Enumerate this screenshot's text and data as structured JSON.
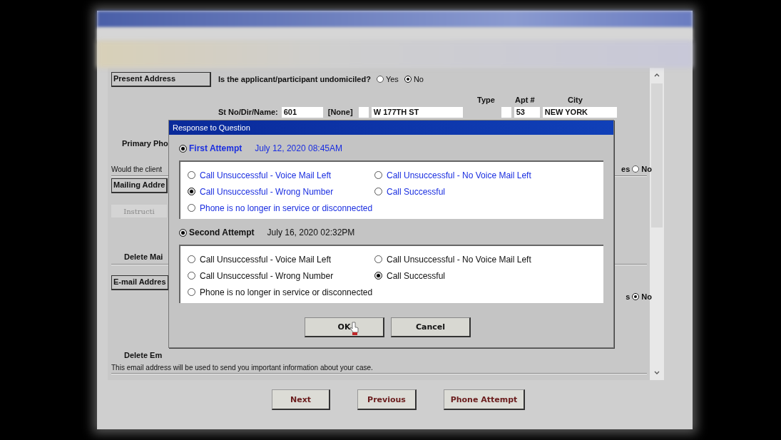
{
  "form": {
    "present_address": "Present Address",
    "undomiciled": {
      "question": "Is the applicant/participant undomiciled?",
      "options": [
        {
          "label": "Yes",
          "selected": false
        },
        {
          "label": "No",
          "selected": true
        }
      ]
    },
    "headers": [
      "Type",
      "Apt #",
      "City"
    ],
    "street": {
      "label": "St No/Dir/Name:",
      "number": "601",
      "direction": "[None]",
      "name": "W 177TH ST",
      "apt": "53",
      "city": "NEW YORK"
    },
    "primary_phone": "Primary Pho",
    "would_client": "Would the client",
    "would_client_yes": "es",
    "would_client_no": {
      "label": "No",
      "selected": false
    },
    "mailing_address": "Mailing Addre",
    "instructions": "Instructi",
    "delete_mailing": "Delete Mai",
    "email_address": "E-mail Addres",
    "email_yes": "s",
    "email_no": {
      "label": "No",
      "selected": true
    },
    "delete_email": "Delete Em",
    "email_note": "This email address will be used to send you important information about your case."
  },
  "dialog": {
    "title": "Response to Question",
    "attempts": [
      {
        "label": "First Attempt",
        "date": "July 12, 2020 08:45AM",
        "selected": true,
        "current": true,
        "options": [
          {
            "label": "Call Unsuccessful - Voice Mail Left",
            "selected": false
          },
          {
            "label": "Call Unsuccessful - No Voice Mail Left",
            "selected": false
          },
          {
            "label": "Call Unsuccessful - Wrong Number",
            "selected": true
          },
          {
            "label": "Call Successful",
            "selected": false
          },
          {
            "label": "Phone is no longer in service or disconnected",
            "selected": false
          }
        ]
      },
      {
        "label": "Second Attempt",
        "date": "July 16, 2020 02:32PM",
        "selected": true,
        "current": false,
        "options": [
          {
            "label": "Call Unsuccessful - Voice Mail Left",
            "selected": false
          },
          {
            "label": "Call Unsuccessful - No Voice Mail Left",
            "selected": false
          },
          {
            "label": "Call Unsuccessful - Wrong Number",
            "selected": false
          },
          {
            "label": "Call Successful",
            "selected": true
          },
          {
            "label": "Phone is no longer in service or disconnected",
            "selected": false
          }
        ]
      }
    ],
    "buttons": [
      "OK",
      "Cancel"
    ]
  },
  "buttons": [
    "Next",
    "Previous",
    "Phone Attempt"
  ]
}
